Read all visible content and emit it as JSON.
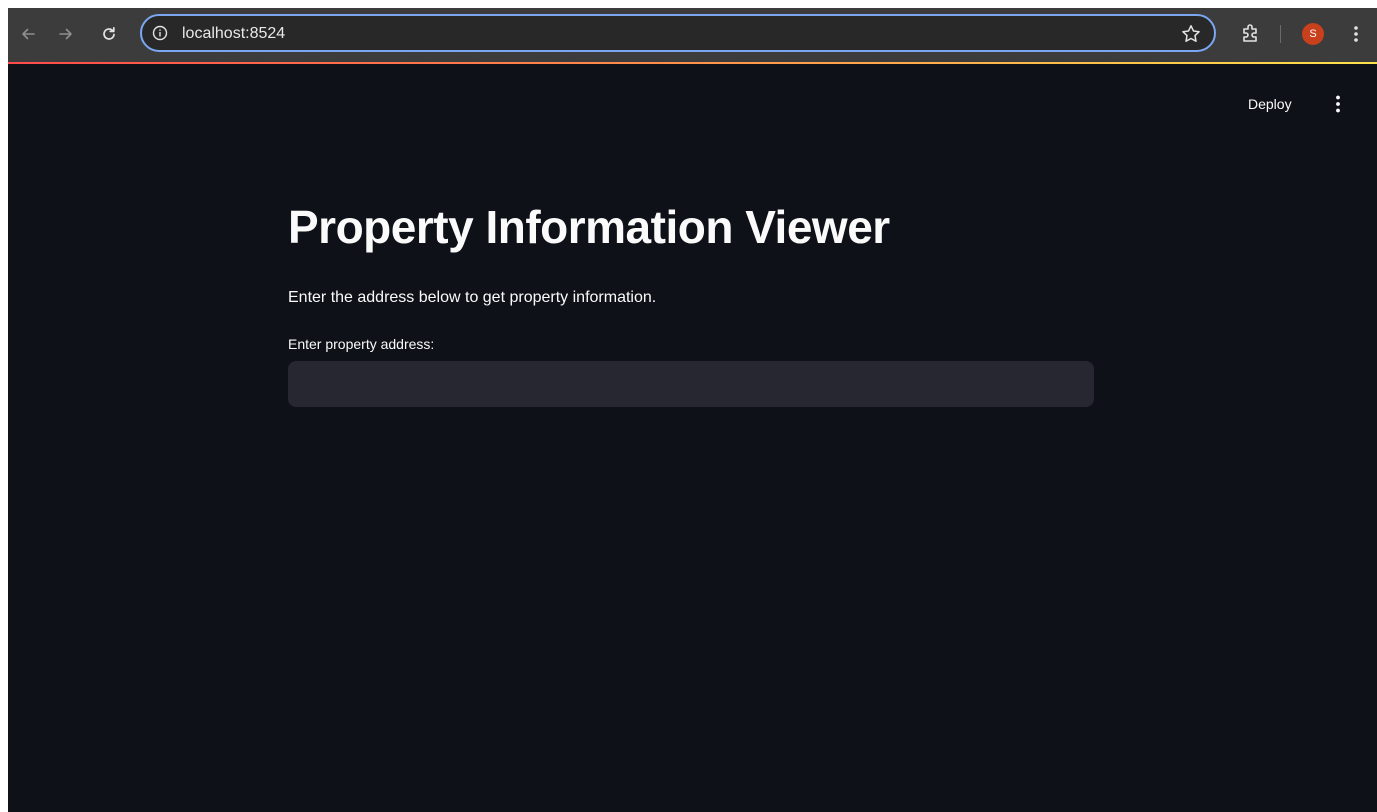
{
  "browser": {
    "url": "localhost:8524",
    "profile_initial": "S",
    "accent_color": "#7aa7f0",
    "avatar_color": "#c8411c"
  },
  "app_header": {
    "deploy_label": "Deploy"
  },
  "main": {
    "title": "Property Information Viewer",
    "description": "Enter the address below to get property information.",
    "address_label": "Enter property address:",
    "address_value": "",
    "address_placeholder": ""
  },
  "colors": {
    "background": "#0e1117",
    "input_background": "#262730",
    "text": "#fafafa",
    "toolbar": "#3c3c3c"
  }
}
